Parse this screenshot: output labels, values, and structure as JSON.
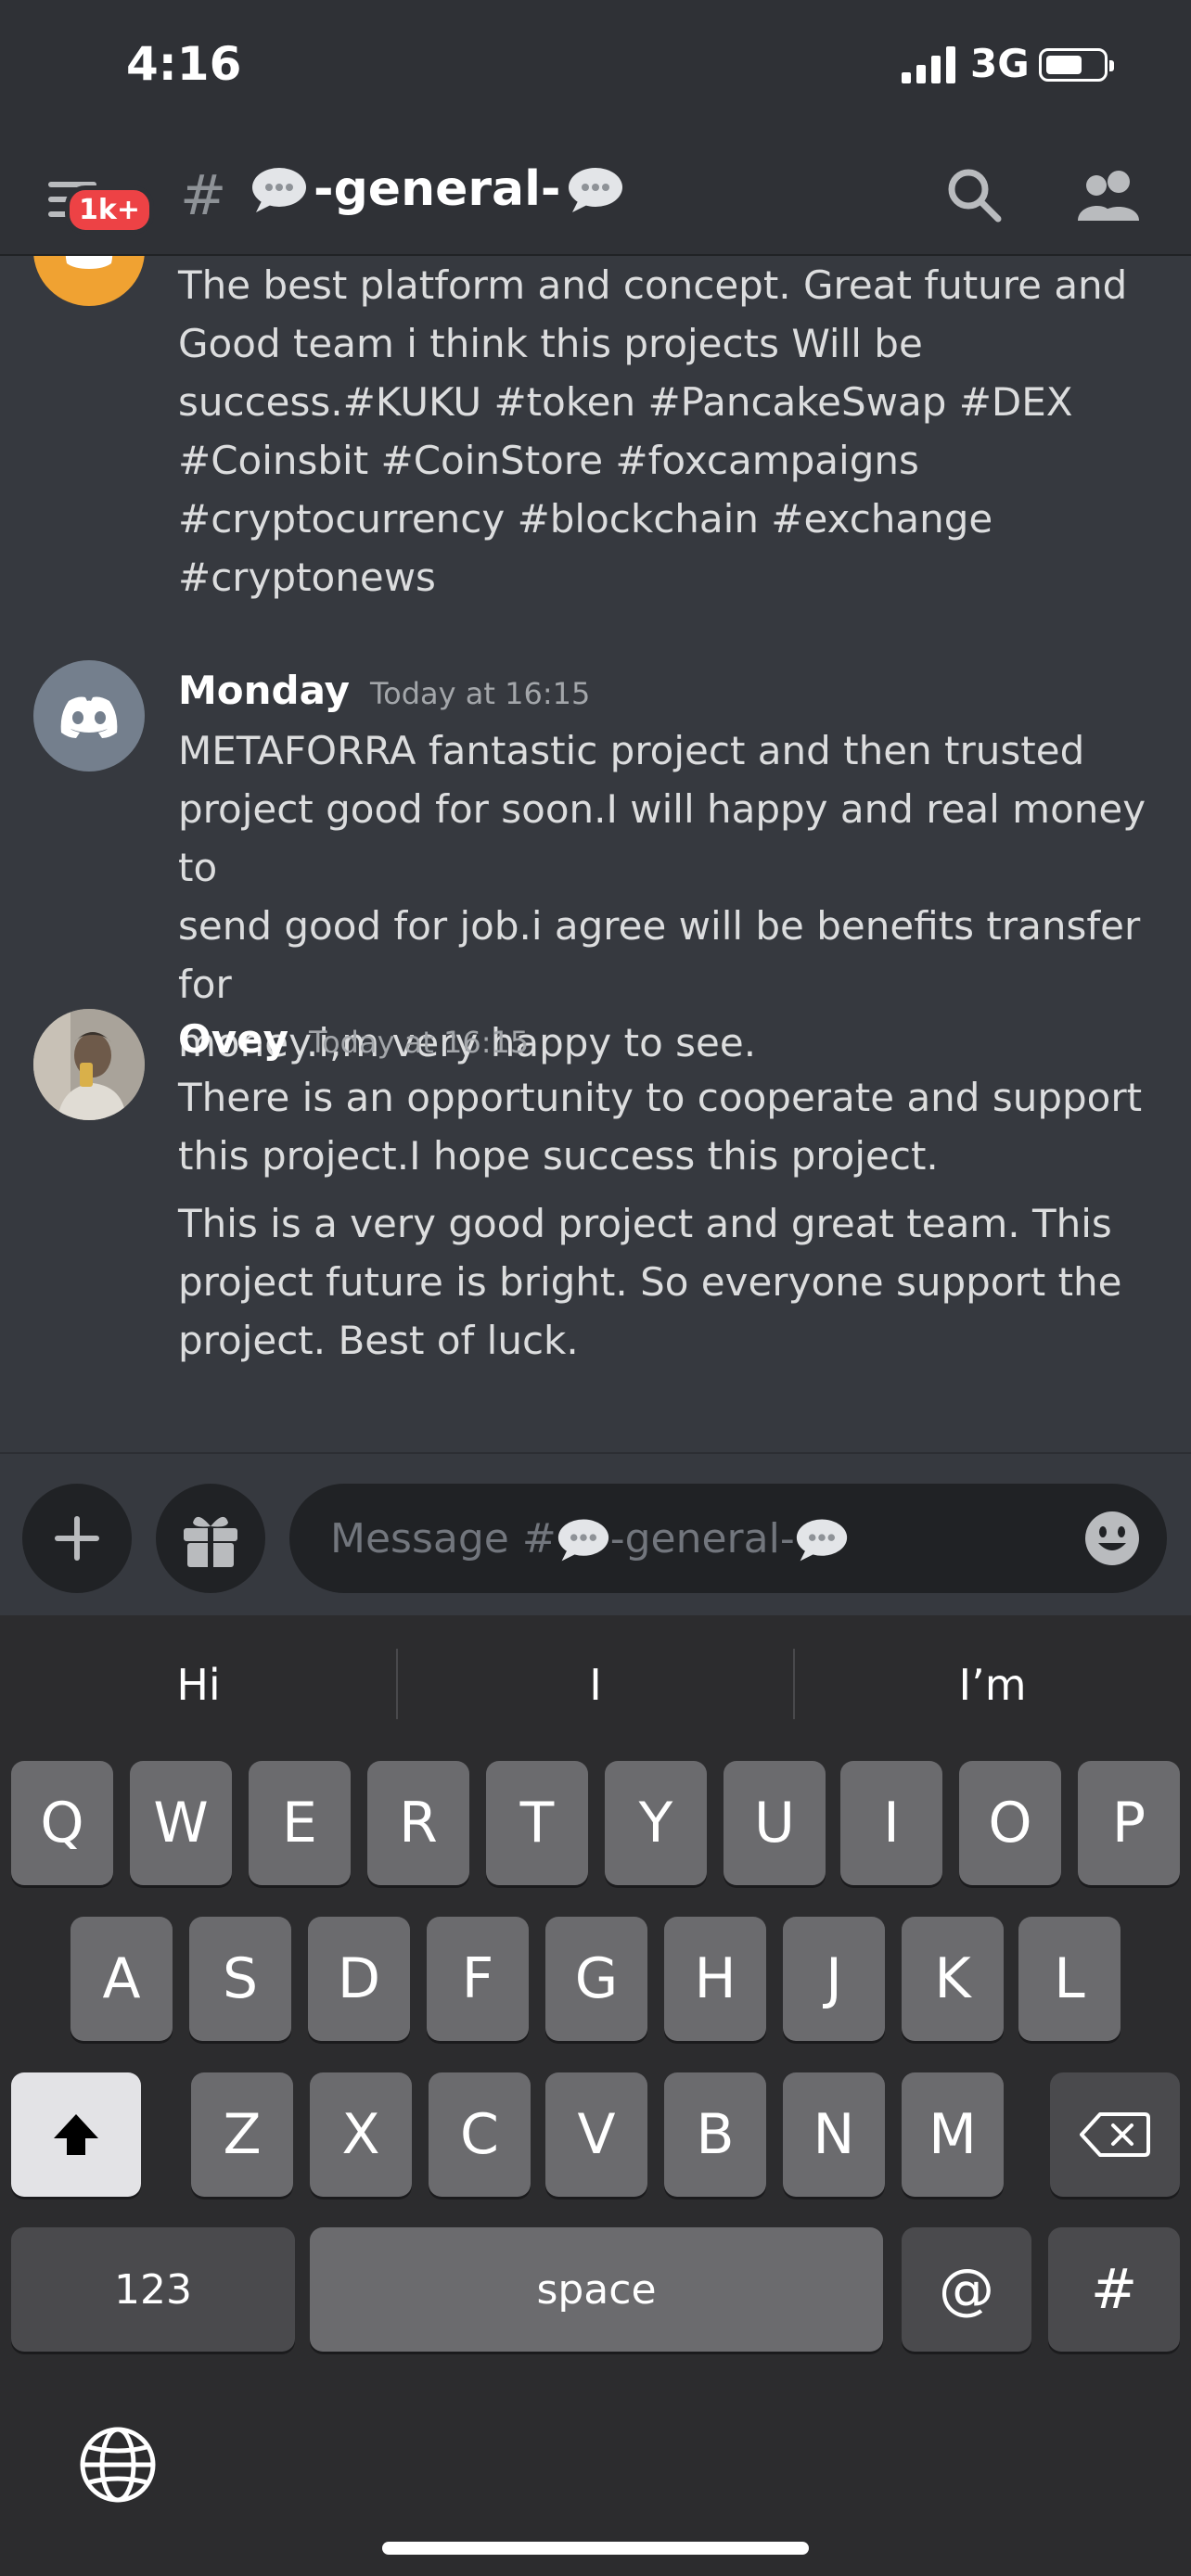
{
  "status": {
    "time": "4:16",
    "network": "3G"
  },
  "header": {
    "badge": "1k+",
    "hash": "#",
    "channel_name": "-general-"
  },
  "messages": [
    {
      "text": "The best platform and concept. Great future and\nGood team i think this projects Will be\nsuccess.#KUKU #token #PancakeSwap #DEX\n#Coinsbit #CoinStore #foxcampaigns\n#cryptocurrency #blockchain #exchange\n#cryptonews"
    },
    {
      "author": "Monday",
      "timestamp": "Today at 16:15",
      "text": "METAFORRA fantastic project and then trusted\nproject good for soon.I will happy and real money to\nsend good for job.i agree will be benefits transfer for\nmoney.i,m very happy to see."
    },
    {
      "author": "Ovey",
      "timestamp": "Today at 16:15",
      "text": "There is an opportunity to cooperate and support\nthis project.I hope success this project.",
      "text2": "This is a very good project and great team. This\nproject future is bright. So everyone support the\nproject. Best of luck."
    }
  ],
  "composer": {
    "placeholder_prefix": "Message #",
    "placeholder_channel": "-general-"
  },
  "keyboard": {
    "suggestions": [
      "Hi",
      "I",
      "I’m"
    ],
    "row1": [
      "Q",
      "W",
      "E",
      "R",
      "T",
      "Y",
      "U",
      "I",
      "O",
      "P"
    ],
    "row2": [
      "A",
      "S",
      "D",
      "F",
      "G",
      "H",
      "J",
      "K",
      "L"
    ],
    "row3": [
      "Z",
      "X",
      "C",
      "V",
      "B",
      "N",
      "M"
    ],
    "numbers_key": "123",
    "space_key": "space",
    "at_key": "@",
    "hash_key": "#"
  },
  "colors": {
    "background": "#36393f",
    "header": "#2f3136",
    "badge": "#ed4245",
    "avatar_orange": "#f0a232",
    "avatar_grey": "#747f8d"
  }
}
